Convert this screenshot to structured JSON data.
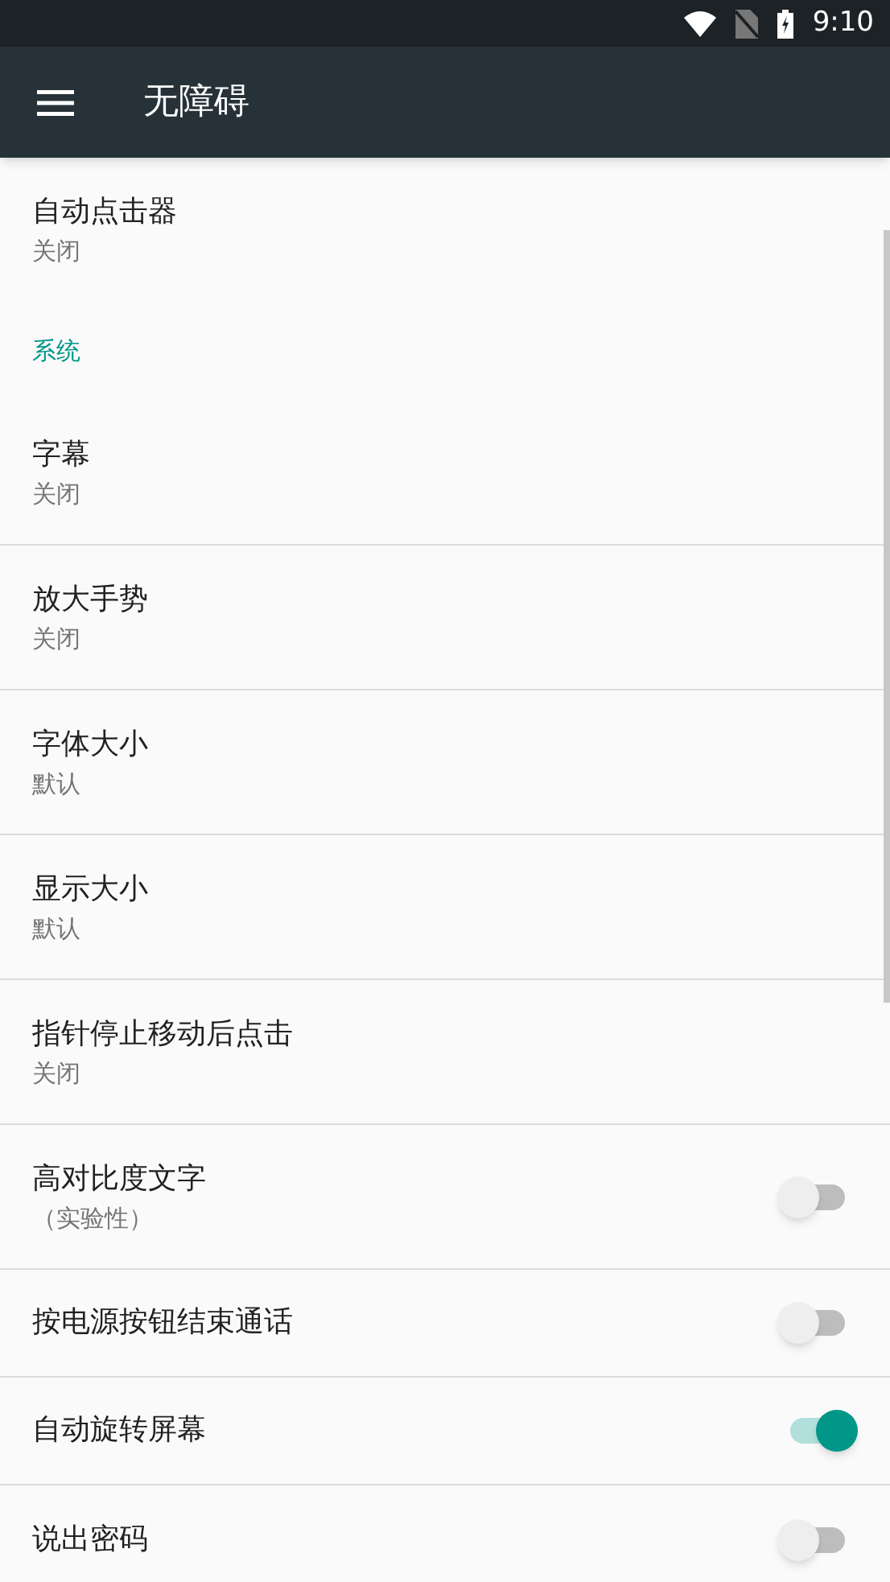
{
  "status_bar": {
    "time": "9:10"
  },
  "app_bar": {
    "title": "无障碍"
  },
  "items": [
    {
      "kind": "item",
      "title": "自动点击器",
      "summary": "关闭"
    },
    {
      "kind": "header",
      "title": "系统"
    },
    {
      "kind": "item",
      "title": "字幕",
      "summary": "关闭"
    },
    {
      "kind": "item",
      "title": "放大手势",
      "summary": "关闭"
    },
    {
      "kind": "item",
      "title": "字体大小",
      "summary": "默认"
    },
    {
      "kind": "item",
      "title": "显示大小",
      "summary": "默认"
    },
    {
      "kind": "item",
      "title": "指针停止移动后点击",
      "summary": "关闭"
    },
    {
      "kind": "switch",
      "title": "高对比度文字",
      "summary": "（实验性）",
      "on": false
    },
    {
      "kind": "switch",
      "title": "按电源按钮结束通话",
      "on": false
    },
    {
      "kind": "switch",
      "title": "自动旋转屏幕",
      "on": true
    },
    {
      "kind": "switch",
      "title": "说出密码",
      "on": false
    }
  ]
}
